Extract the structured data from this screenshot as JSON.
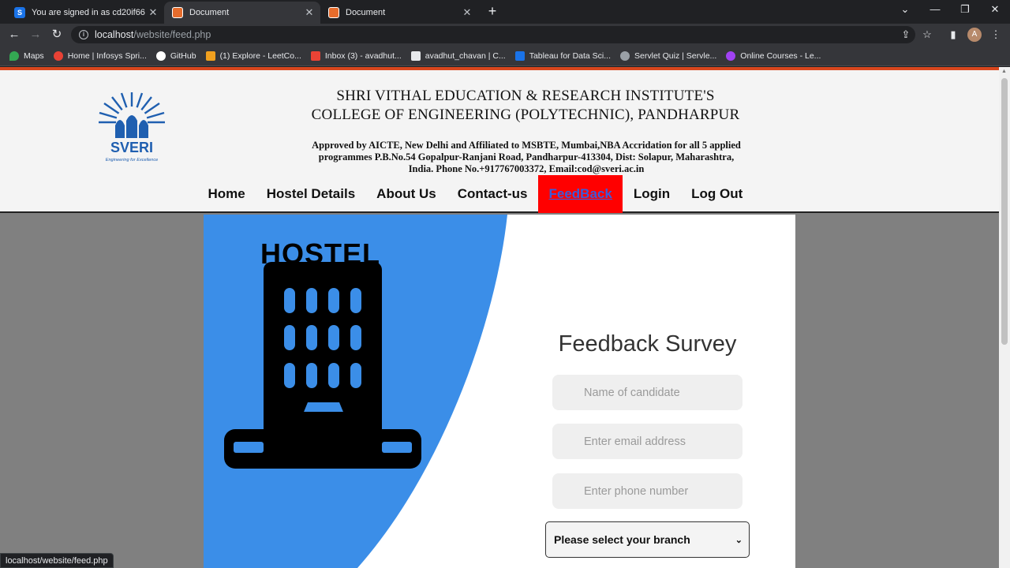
{
  "browser": {
    "tabs": [
      {
        "title": "You are signed in as cd20if66",
        "favicon": "S",
        "active": false
      },
      {
        "title": "Document",
        "favicon": "html-icon",
        "active": true
      },
      {
        "title": "Document",
        "favicon": "html-icon",
        "active": false
      }
    ],
    "url_host": "localhost",
    "url_path": "/website/feed.php",
    "profile_initial": "A",
    "bookmarks": [
      {
        "label": "Maps",
        "color": "#34a853"
      },
      {
        "label": "Home | Infosys Spri...",
        "color": "#e94235"
      },
      {
        "label": "GitHub",
        "color": "#ffffff"
      },
      {
        "label": "(1) Explore - LeetCo...",
        "color": "#f0a01f"
      },
      {
        "label": "Inbox (3) - avadhut...",
        "color": "#ea4335"
      },
      {
        "label": "avadhut_chavan | C...",
        "color": "#e8eaed"
      },
      {
        "label": "Tableau for Data Sci...",
        "color": "#1a73e8"
      },
      {
        "label": "Servlet Quiz | Servle...",
        "color": "#9aa0a6"
      },
      {
        "label": "Online Courses - Le...",
        "color": "#a142f4"
      }
    ],
    "status_url": "localhost/website/feed.php"
  },
  "site": {
    "logo_text": "SVERI",
    "logo_tagline": "Engineering for Excellence",
    "institute_line1": "SHRI VITHAL EDUCATION & RESEARCH INSTITUTE'S",
    "institute_line2": "COLLEGE OF ENGINEERING (POLYTECHNIC), PANDHARPUR",
    "approved_line1": "Approved by AICTE, New Delhi and Affiliated to MSBTE, Mumbai,NBA Accridation for all 5 applied",
    "approved_line2": "programmes P.B.No.54 Gopalpur-Ranjani Road, Pandharpur-413304, Dist: Solapur, Maharashtra,",
    "approved_line3": "India. Phone No.+917767003372, Email:cod@sveri.ac.in",
    "nav": [
      "Home",
      "Hostel Details",
      "About Us",
      "Contact-us",
      "FeedBack",
      "Login",
      "Log Out"
    ],
    "active_nav": "FeedBack"
  },
  "illustration": {
    "label": "HOSTEL",
    "accent": "#3b8ee8"
  },
  "form": {
    "title": "Feedback Survey",
    "name_placeholder": "Name of candidate",
    "email_placeholder": "Enter email address",
    "phone_placeholder": "Enter phone number",
    "branch_selected": "Please select your branch"
  }
}
